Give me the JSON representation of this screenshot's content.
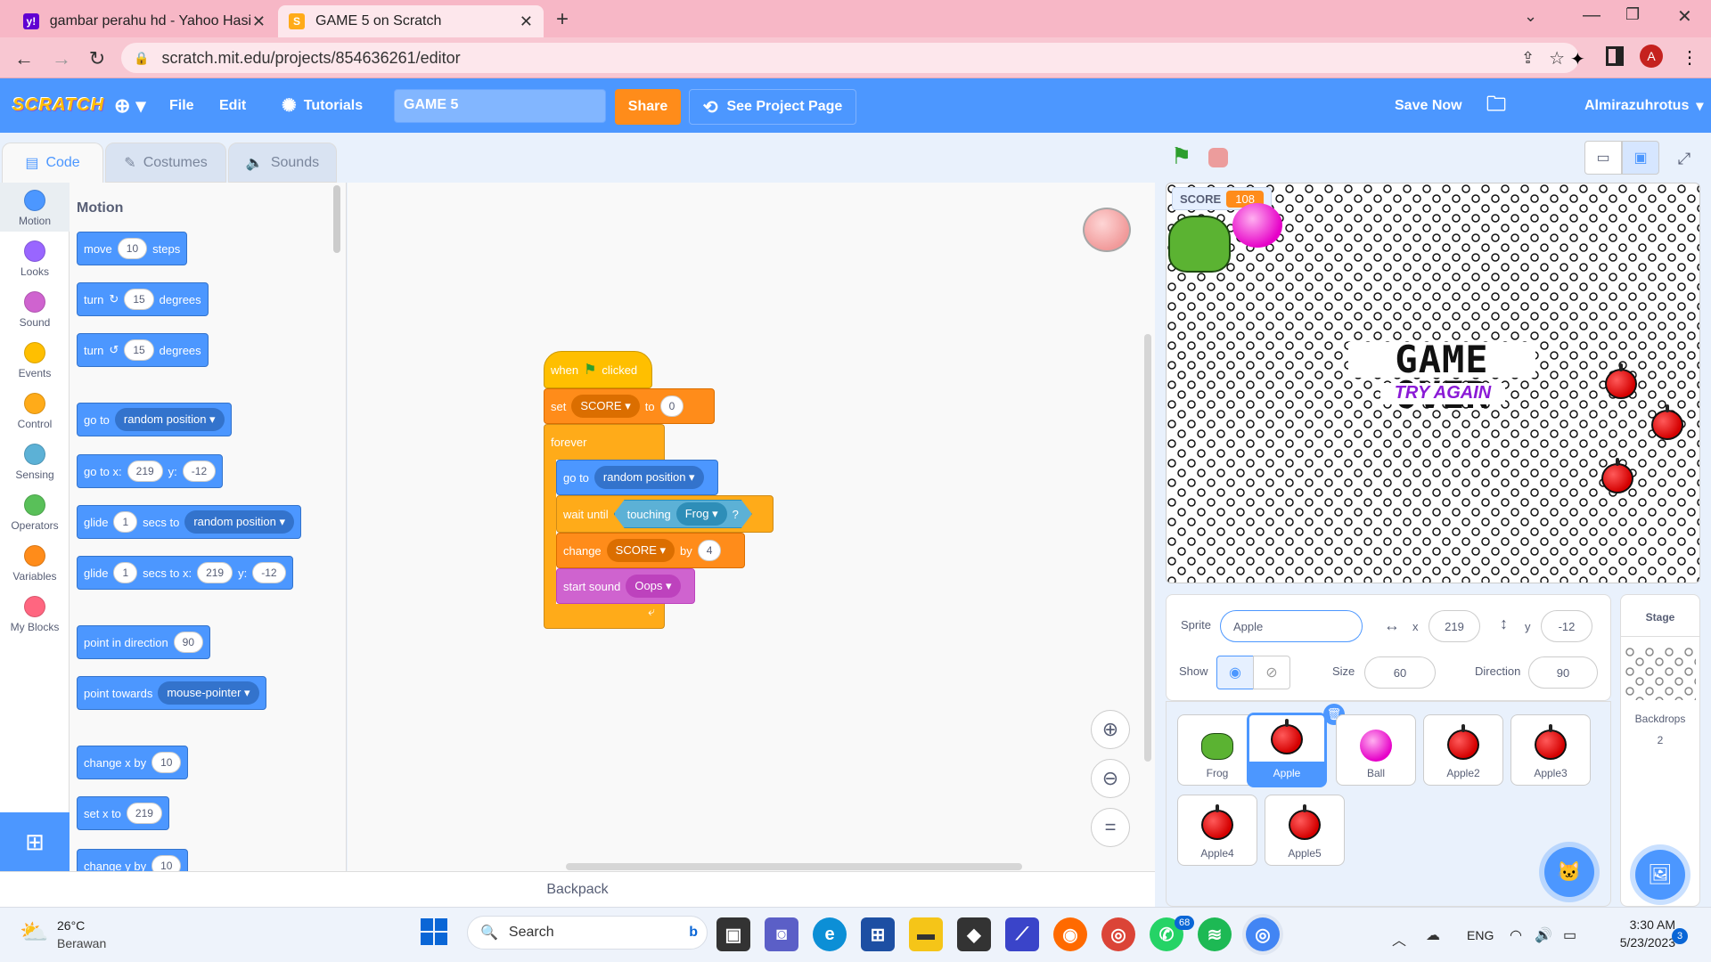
{
  "browser": {
    "tabs": [
      {
        "title": "gambar perahu hd - Yahoo Hasil",
        "favicon": "y!"
      },
      {
        "title": "GAME 5 on Scratch",
        "favicon": "S"
      }
    ],
    "url": "scratch.mit.edu/projects/854636261/editor",
    "profile_initial": "A"
  },
  "menubar": {
    "logo": "SCRATCH",
    "file": "File",
    "edit": "Edit",
    "tutorials": "Tutorials",
    "project_title": "GAME 5",
    "share": "Share",
    "see_project": "See Project Page",
    "save_now": "Save Now",
    "username": "Almirazuhrotus"
  },
  "editor_tabs": {
    "code": "Code",
    "costumes": "Costumes",
    "sounds": "Sounds"
  },
  "categories": [
    {
      "label": "Motion",
      "color": "#4c97ff"
    },
    {
      "label": "Looks",
      "color": "#9966ff"
    },
    {
      "label": "Sound",
      "color": "#cf63cf"
    },
    {
      "label": "Events",
      "color": "#ffbf00"
    },
    {
      "label": "Control",
      "color": "#ffab19"
    },
    {
      "label": "Sensing",
      "color": "#5cb1d6"
    },
    {
      "label": "Operators",
      "color": "#59c059"
    },
    {
      "label": "Variables",
      "color": "#ff8c1a"
    },
    {
      "label": "My Blocks",
      "color": "#ff6680"
    }
  ],
  "palette": {
    "heading": "Motion",
    "move": {
      "pre": "move",
      "val": "10",
      "post": "steps"
    },
    "turn_cw": {
      "pre": "turn",
      "val": "15",
      "post": "degrees"
    },
    "turn_ccw": {
      "pre": "turn",
      "val": "15",
      "post": "degrees"
    },
    "goto": {
      "pre": "go to",
      "dd": "random position"
    },
    "gotoxy": {
      "pre": "go to x:",
      "x": "219",
      "ylab": "y:",
      "y": "-12"
    },
    "glide": {
      "pre": "glide",
      "val": "1",
      "mid": "secs to",
      "dd": "random position"
    },
    "glidexy": {
      "pre": "glide",
      "val": "1",
      "mid": "secs to x:",
      "x": "219",
      "ylab": "y:",
      "y": "-12"
    },
    "point_dir": {
      "pre": "point in direction",
      "val": "90"
    },
    "point_towards": {
      "pre": "point towards",
      "dd": "mouse-pointer"
    },
    "change_x": {
      "pre": "change x by",
      "val": "10"
    },
    "set_x": {
      "pre": "set x to",
      "val": "219"
    },
    "change_y": {
      "pre": "change y by",
      "val": "10"
    }
  },
  "script": {
    "hat": {
      "pre": "when",
      "post": "clicked"
    },
    "set": {
      "pre": "set",
      "dd": "SCORE",
      "mid": "to",
      "val": "0"
    },
    "forever": "forever",
    "goto": {
      "pre": "go to",
      "dd": "random position"
    },
    "wait": {
      "pre": "wait until",
      "touch": "touching",
      "dd": "Frog",
      "q": "?"
    },
    "change": {
      "pre": "change",
      "dd": "SCORE",
      "mid": "by",
      "val": "4"
    },
    "sound": {
      "pre": "start sound",
      "dd": "Oops"
    }
  },
  "backpack": "Backpack",
  "stage": {
    "monitor_label": "SCORE",
    "monitor_value": "108",
    "game_over": "GAME OVER",
    "try_again": "TRY AGAIN"
  },
  "sprite_info": {
    "sprite_label": "Sprite",
    "sprite_name": "Apple",
    "x_label": "x",
    "x": "219",
    "y_label": "y",
    "y": "-12",
    "show_label": "Show",
    "size_label": "Size",
    "size": "60",
    "direction_label": "Direction",
    "direction": "90"
  },
  "sprites": [
    "Frog",
    "Apple",
    "Ball",
    "Apple2",
    "Apple3",
    "Apple4",
    "Apple5"
  ],
  "stage_panel": {
    "label": "Stage",
    "backdrops_label": "Backdrops",
    "backdrops_count": "2"
  },
  "taskbar": {
    "weather_temp": "26°C",
    "weather_desc": "Berawan",
    "search": "Search",
    "lang": "ENG",
    "time": "3:30 AM",
    "date": "5/23/2023",
    "whatsapp_badge": "68",
    "notif_count": "3"
  }
}
